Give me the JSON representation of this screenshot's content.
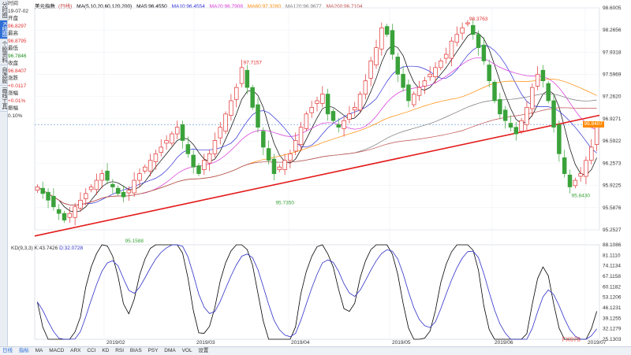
{
  "sidebar": {
    "tabs": [
      "分时图",
      "K线图",
      "个股资料",
      "自选股",
      "画线工具"
    ]
  },
  "info_panel": [
    {
      "label": "时间",
      "value": "19-07-02",
      "color": "normal"
    },
    {
      "label": "开盘",
      "value": "96.8297",
      "color": "red"
    },
    {
      "label": "最高",
      "value": "96.8795",
      "color": "red"
    },
    {
      "label": "最低",
      "value": "96.7846",
      "color": "green"
    },
    {
      "label": "收盘",
      "value": "96.8407",
      "color": "red"
    },
    {
      "label": "涨跌",
      "value": "+0.0117",
      "color": "red"
    },
    {
      "label": "涨幅",
      "value": "+0.01%",
      "color": "red"
    },
    {
      "label": "振幅",
      "value": "0.10%",
      "color": "normal"
    }
  ],
  "header": {
    "title": "美元指数",
    "period": "(日线)",
    "ma_setting": "MA(5,10,20,60,120,200)",
    "ma5": "MA5:96.4550",
    "ma10": "MA10:96.4554",
    "ma20": "MA20:96.7908",
    "ma60": "MA60:97.3280",
    "ma120": "MA120:96.9677",
    "ma200": "MA200:96.7104"
  },
  "main_price_tag": "96.8407",
  "annotations": {
    "high1": "97.7157",
    "high2": "98.3763",
    "low1": "95.7350",
    "low2": "95.1588",
    "low3": "95.8430"
  },
  "kd": {
    "title": "KD(9,3,3)",
    "k": "K:43.7426",
    "d": "D:32.0728",
    "y_labels": [
      "88.1086",
      "81.1110",
      "74.1134",
      "67.1158",
      "60.1182",
      "53.1206",
      "46.1231",
      "39.1255",
      "32.1279",
      "25.1303"
    ]
  },
  "price_axis": [
    "98.6005",
    "98.2656",
    "97.9318",
    "97.5969",
    "97.2620",
    "96.9271",
    "96.5922",
    "96.2573",
    "95.9225",
    "95.5876",
    "95.2527"
  ],
  "x_axis": [
    "2019/02",
    "2019/03",
    "2019/04",
    "2019/05",
    "2019/06",
    "2019/07"
  ],
  "bottom_bar": [
    "日线",
    "指标",
    "MA",
    "MACD",
    "ARX",
    "CCI",
    "KD",
    "RSI",
    "BIAS",
    "PSY",
    "DMA",
    "VOL",
    "设置"
  ],
  "watermark": "FX678",
  "colors": {
    "up": "#e03030",
    "down": "#3aa23a",
    "ma5": "#000000",
    "ma10": "#2f2fd6",
    "ma20": "#d633d6",
    "ma60": "#ff8a00",
    "ma120": "#777777",
    "ma200": "#c05050",
    "trendline": "#e31b1b",
    "k_line": "#000000",
    "d_line": "#3030c8"
  },
  "chart_data": {
    "type": "line",
    "title": "美元指数 (日线)",
    "ylim": [
      95.2527,
      98.6005
    ],
    "x_ticks": [
      "2019/02",
      "2019/03",
      "2019/04",
      "2019/05",
      "2019/06",
      "2019/07"
    ],
    "candles_close": [
      95.9,
      95.8,
      95.7,
      95.6,
      95.5,
      95.4,
      95.5,
      95.6,
      95.7,
      95.8,
      95.9,
      96.0,
      96.1,
      96.0,
      95.9,
      95.8,
      95.75,
      95.85,
      96.0,
      96.1,
      96.2,
      96.3,
      96.4,
      96.5,
      96.6,
      96.7,
      96.8,
      96.6,
      96.4,
      96.2,
      96.1,
      96.3,
      96.4,
      96.6,
      96.8,
      97.0,
      97.2,
      97.4,
      97.7,
      97.4,
      97.1,
      96.8,
      96.5,
      96.3,
      96.1,
      96.2,
      96.3,
      96.4,
      96.6,
      96.8,
      97.0,
      97.1,
      97.2,
      97.3,
      97.0,
      96.9,
      96.8,
      96.9,
      97.0,
      97.1,
      97.3,
      97.5,
      97.8,
      98.0,
      98.3,
      98.2,
      97.9,
      97.6,
      97.4,
      97.2,
      97.3,
      97.4,
      97.5,
      97.6,
      97.7,
      97.8,
      97.9,
      98.1,
      98.2,
      98.3,
      98.376,
      98.2,
      98.0,
      97.8,
      97.5,
      97.2,
      97.0,
      96.9,
      96.8,
      96.7,
      96.9,
      97.1,
      97.4,
      97.6,
      97.5,
      97.2,
      96.8,
      96.4,
      96.1,
      95.9,
      96.0,
      96.1,
      96.3,
      96.5,
      96.8
    ],
    "kd_k_last": 43.7426,
    "kd_d_last": 32.0728
  }
}
